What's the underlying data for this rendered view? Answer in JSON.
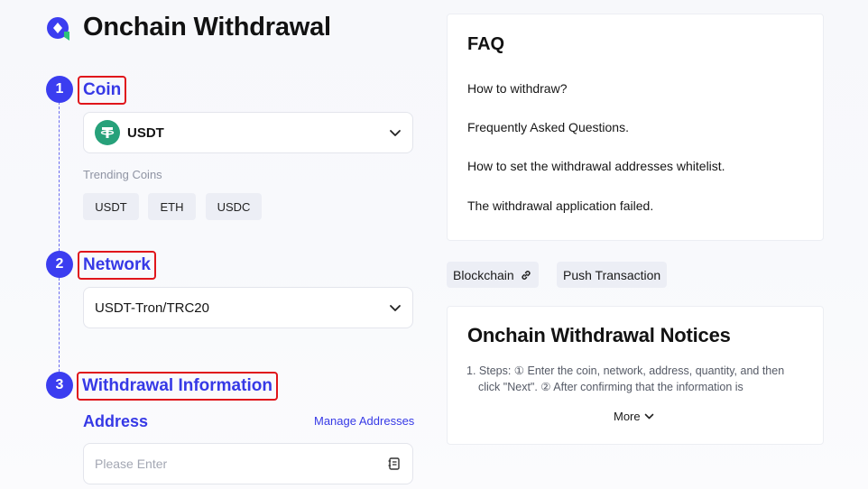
{
  "page": {
    "title": "Onchain Withdrawal"
  },
  "steps": [
    {
      "number": "1",
      "title": "Coin"
    },
    {
      "number": "2",
      "title": "Network"
    },
    {
      "number": "3",
      "title": "Withdrawal Information"
    }
  ],
  "coin": {
    "selected": "USDT",
    "trending_label": "Trending Coins",
    "trending": [
      "USDT",
      "ETH",
      "USDC"
    ]
  },
  "network": {
    "selected": "USDT-Tron/TRC20"
  },
  "withdrawal": {
    "address_label": "Address",
    "manage_link": "Manage Addresses",
    "address_placeholder": "Please Enter"
  },
  "faq": {
    "title": "FAQ",
    "items": [
      "How to withdraw?",
      "Frequently Asked Questions.",
      "How to set the withdrawal addresses whitelist.",
      "The withdrawal application failed."
    ]
  },
  "links": {
    "blockchain": "Blockchain",
    "push_transaction": "Push Transaction"
  },
  "notices": {
    "title": "Onchain Withdrawal Notices",
    "line1": "1. Steps: ① Enter the coin, network, address, quantity, and then",
    "line2": "click \"Next\". ② After confirming that the information is",
    "more": "More"
  },
  "colors": {
    "accent": "#3639e6",
    "step_circle": "#3b3df0",
    "highlight_border": "#e0151b",
    "tether_green": "#27a17a"
  },
  "icons": [
    "logo-icon",
    "tether-icon",
    "chevron-down-icon",
    "link-icon",
    "address-book-icon"
  ]
}
